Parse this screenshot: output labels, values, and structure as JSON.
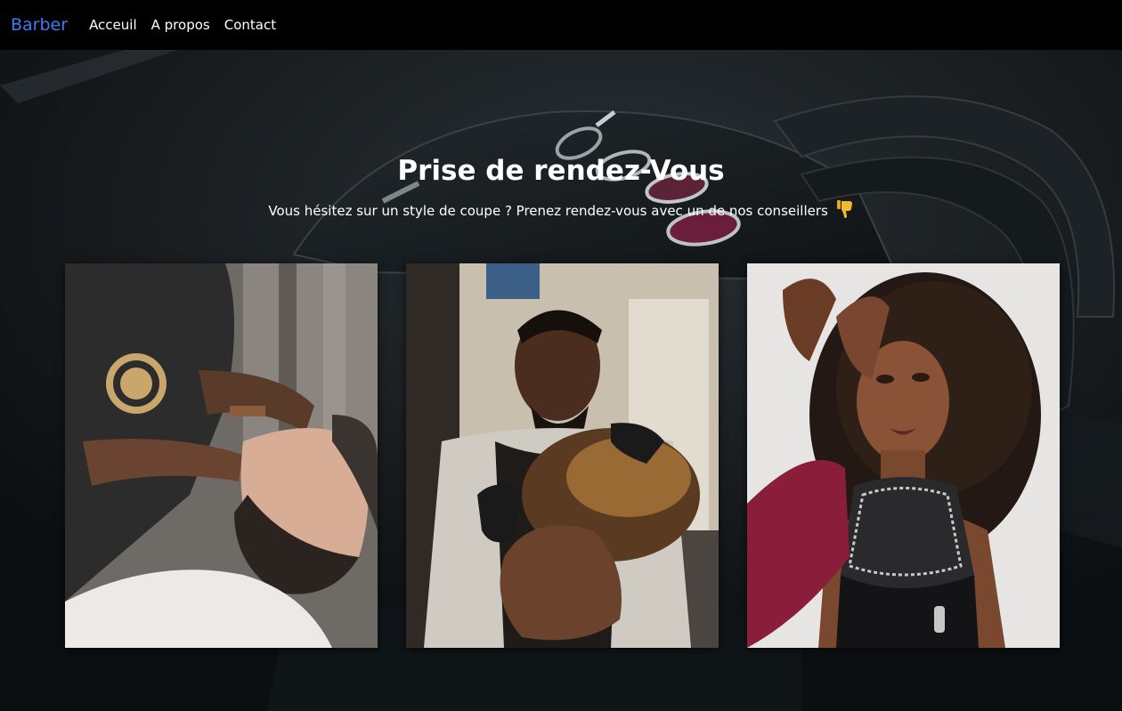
{
  "navbar": {
    "brand": "Barber",
    "links": [
      "Acceuil",
      "A propos",
      "Contact"
    ]
  },
  "hero": {
    "title": "Prise de rendez-Vous",
    "subtitle": "Vous hésitez sur un style de coupe ? Prenez rendez-vous avec un de nos conseillers",
    "subtitle_emoji": "thumbs-down-icon"
  },
  "gallery": {
    "images": [
      {
        "subject": "barber-beard-trim-photo"
      },
      {
        "subject": "barber-haircut-photo"
      },
      {
        "subject": "woman-hair-styling-photo"
      }
    ]
  },
  "colors": {
    "brand": "#3d7bf4",
    "navbar_bg": "#000000",
    "text": "#ffffff"
  }
}
